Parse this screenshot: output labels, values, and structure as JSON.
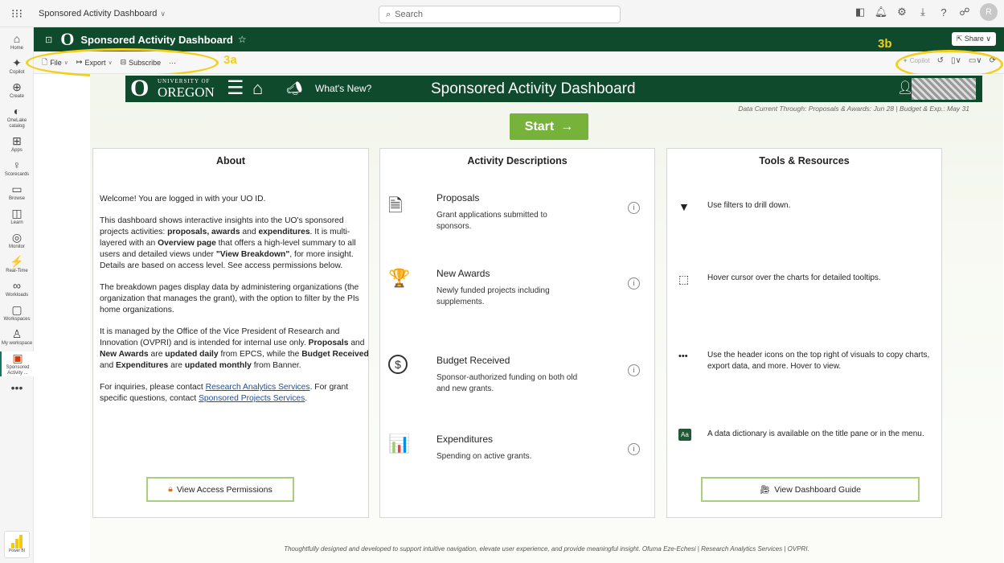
{
  "app": {
    "breadcrumb": "Sponsored Activity Dashboard",
    "search_placeholder": "Search",
    "avatar_initial": "R"
  },
  "nav": [
    {
      "icon": "⌂",
      "label": "Home"
    },
    {
      "icon": "✦",
      "label": "Copilot"
    },
    {
      "icon": "⊕",
      "label": "Create"
    },
    {
      "icon": "◐",
      "label": "OneLake catalog"
    },
    {
      "icon": "⊞",
      "label": "Apps"
    },
    {
      "icon": "♀",
      "label": "Scorecards"
    },
    {
      "icon": "▭",
      "label": "Browse"
    },
    {
      "icon": "◫",
      "label": "Learn"
    },
    {
      "icon": "◎",
      "label": "Monitor"
    },
    {
      "icon": "⚡",
      "label": "Real-Time"
    },
    {
      "icon": "∞",
      "label": "Workloads"
    },
    {
      "icon": "▢",
      "label": "Workspaces"
    },
    {
      "icon": "♙",
      "label": "My workspace"
    },
    {
      "icon": "▣",
      "label": "Sponsored Activity ..."
    },
    {
      "icon": "•••",
      "label": ""
    }
  ],
  "powerbi_label": "Power BI",
  "report": {
    "title": "Sponsored Activity Dashboard",
    "share_label": "Share",
    "toolbar": {
      "file": "File",
      "export": "Export",
      "subscribe": "Subscribe",
      "more": "···",
      "copilot": "Copilot"
    }
  },
  "annotations": {
    "a": "3a",
    "b": "3b"
  },
  "banner": {
    "univ": "UNIVERSITY OF",
    "oregon": "OREGON",
    "whats_new": "What's New?",
    "title": "Sponsored Activity Dashboard"
  },
  "data_current": "Data Current Through: Proposals & Awards: Jun 28 | Budget & Exp.: May 31",
  "start_label": "Start",
  "about": {
    "heading": "About",
    "welcome": "Welcome! You are logged in with your UO ID.",
    "p2_a": "This dashboard shows interactive insights into the UO's sponsored projects activities: ",
    "p2_b": "proposals, awards",
    "p2_c": " and ",
    "p2_d": "expenditures",
    "p2_e": ". It is multi-layered with an ",
    "p2_f": "Overview page",
    "p2_g": " that offers a high-level summary to all users and detailed views under ",
    "p2_h": "\"View Breakdown\"",
    "p2_i": ", for more insight. Details are based on access level. See access permissions below.",
    "p3": "The breakdown pages display data by administering organizations (the organization that manages the grant), with the option to filter by the PIs home organizations.",
    "p4_a": "It is managed by the Office of the Vice President of Research and Innovation (OVPRI) and is intended for internal use only. ",
    "p4_b": "Proposals",
    "p4_c": " and ",
    "p4_d": "New Awards",
    "p4_e": " are ",
    "p4_f": "updated daily",
    "p4_g": " from EPCS, while the ",
    "p4_h": "Budget Received",
    "p4_i": " and ",
    "p4_j": "Expenditures",
    "p4_k": " are ",
    "p4_l": "updated monthly",
    "p4_m": " from Banner.",
    "p5_a": "For inquiries, please contact ",
    "p5_link1": "Research Analytics Services",
    "p5_b": ". For grant specific questions, contact ",
    "p5_link2": "Sponsored Projects Services",
    "p5_c": ".",
    "button": "View Access Permissions"
  },
  "activities": {
    "heading": "Activity Descriptions",
    "items": [
      {
        "icon": "🗎",
        "name": "Proposals",
        "desc": "Grant applications submitted to sponsors."
      },
      {
        "icon": "🏆",
        "name": "New Awards",
        "desc": "Newly funded projects including supplements."
      },
      {
        "icon": "$",
        "name": "Budget Received",
        "desc": "Sponsor-authorized funding on both old and new grants."
      },
      {
        "icon": "📊",
        "name": "Expenditures",
        "desc": "Spending on active grants."
      }
    ]
  },
  "tools": {
    "heading": "Tools & Resources",
    "items": [
      {
        "icon": "▼",
        "text": "Use filters to drill down."
      },
      {
        "icon": "⬚",
        "text": "Hover cursor over the charts for detailed tooltips."
      },
      {
        "icon": "•••",
        "text": "Use the header icons on the top right of visuals to copy charts, export data, and more. Hover to view."
      },
      {
        "icon": "Aa",
        "text": "A data dictionary is available on the title pane or in the menu."
      }
    ],
    "button": "View Dashboard Guide"
  },
  "footer": "Thoughtfully designed and developed to support intuitive navigation, elevate user experience, and provide meaningful insight. Ofuma Eze-Echesi | Research Analytics Services | OVPRI.",
  "colors": {
    "uo_green": "#0f4a2c",
    "accent_green": "#77b23a",
    "annotation_yellow": "#f2cf1d"
  }
}
